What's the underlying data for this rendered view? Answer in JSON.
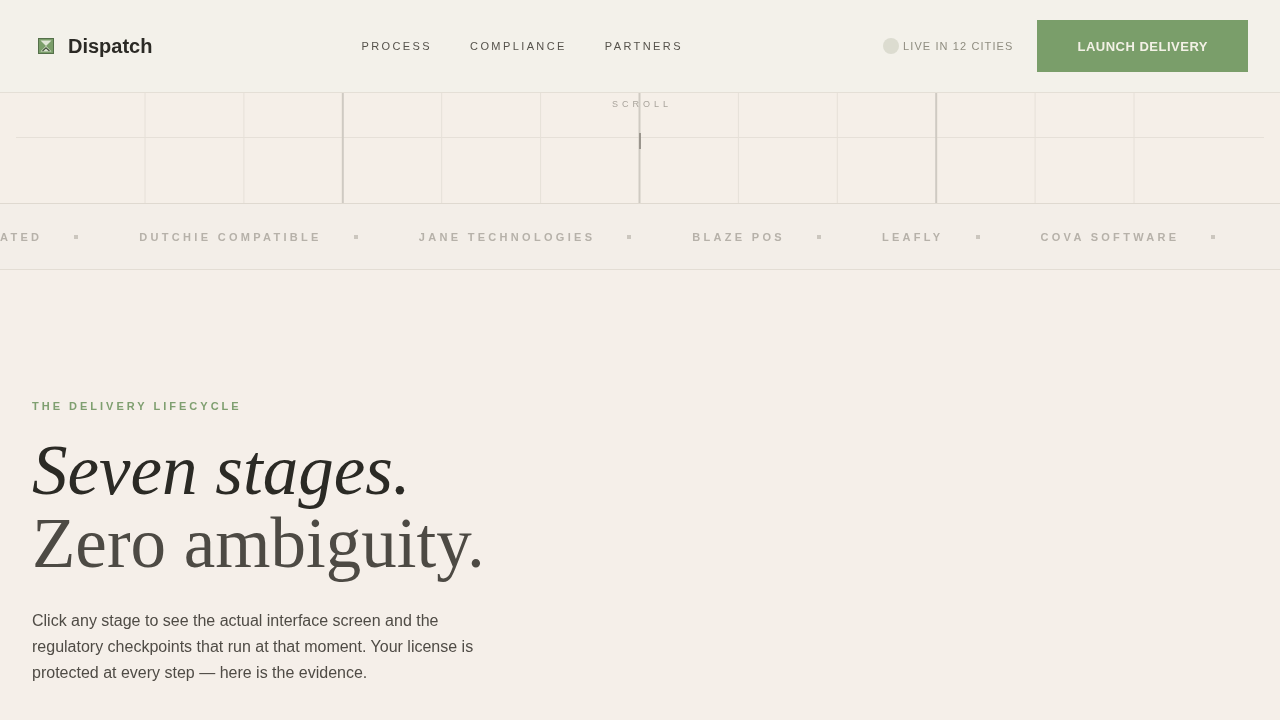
{
  "header": {
    "brand": "Dispatch",
    "nav": [
      {
        "label": "PROCESS"
      },
      {
        "label": "COMPLIANCE"
      },
      {
        "label": "PARTNERS"
      }
    ],
    "status": "LIVE IN 12 CITIES",
    "cta": "LAUNCH DELIVERY"
  },
  "scroll_hint": "SCROLL",
  "partners": [
    "ATED",
    "DUTCHIE COMPATIBLE",
    "JANE TECHNOLOGIES",
    "BLAZE POS",
    "LEAFLY",
    "COVA SOFTWARE"
  ],
  "hero": {
    "eyebrow": "THE DELIVERY LIFECYCLE",
    "title_line_1": "Seven stages.",
    "title_line_2": "Zero ambiguity.",
    "body": "Click any stage to see the actual interface screen and the regulatory checkpoints that run at that moment. Your license is protected at every step — here is the evidence."
  }
}
